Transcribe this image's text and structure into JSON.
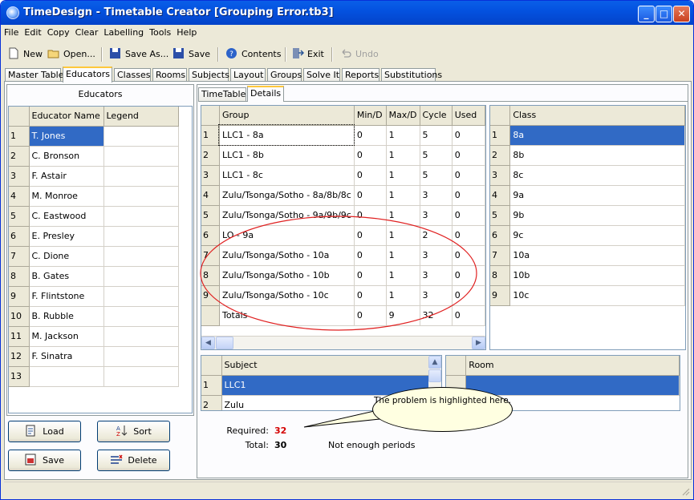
{
  "window": {
    "title": "TimeDesign - Timetable Creator [Grouping Error.tb3]"
  },
  "menu": [
    "File",
    "Edit",
    "Copy",
    "Clear",
    "Labelling",
    "Tools",
    "Help"
  ],
  "toolbar": {
    "new": "New",
    "open": "Open...",
    "save_as": "Save As...",
    "save": "Save",
    "contents": "Contents",
    "exit": "Exit",
    "undo": "Undo"
  },
  "tabs": [
    "Master Table",
    "Educators",
    "Classes",
    "Rooms",
    "Subjects",
    "Layout",
    "Groups",
    "Solve It",
    "Reports",
    "Substitutions"
  ],
  "active_tab": "Educators",
  "educators": {
    "title": "Educators",
    "columns": [
      "Educator Name",
      "Legend"
    ],
    "rows": [
      {
        "n": "1",
        "name": "T. Jones"
      },
      {
        "n": "2",
        "name": "C. Bronson"
      },
      {
        "n": "3",
        "name": "F. Astair"
      },
      {
        "n": "4",
        "name": "M. Monroe"
      },
      {
        "n": "5",
        "name": "C. Eastwood"
      },
      {
        "n": "6",
        "name": "E. Presley"
      },
      {
        "n": "7",
        "name": "C. Dione"
      },
      {
        "n": "8",
        "name": "B. Gates"
      },
      {
        "n": "9",
        "name": "F. Flintstone"
      },
      {
        "n": "10",
        "name": "B. Rubble"
      },
      {
        "n": "11",
        "name": "M. Jackson"
      },
      {
        "n": "12",
        "name": "F. Sinatra"
      },
      {
        "n": "13",
        "name": ""
      }
    ],
    "buttons": {
      "load": "Load",
      "sort": "Sort",
      "save": "Save",
      "delete": "Delete"
    }
  },
  "subtabs": [
    "TimeTable",
    "Details"
  ],
  "groups": {
    "columns": [
      "Group",
      "Min/D",
      "Max/D",
      "Cycle",
      "Used"
    ],
    "rows": [
      {
        "n": "1",
        "group": "LLC1 - 8a",
        "min": "0",
        "max": "1",
        "cycle": "5",
        "used": "0"
      },
      {
        "n": "2",
        "group": "LLC1 - 8b",
        "min": "0",
        "max": "1",
        "cycle": "5",
        "used": "0"
      },
      {
        "n": "3",
        "group": "LLC1 - 8c",
        "min": "0",
        "max": "1",
        "cycle": "5",
        "used": "0"
      },
      {
        "n": "4",
        "group": "Zulu/Tsonga/Sotho - 8a/8b/8c",
        "min": "0",
        "max": "1",
        "cycle": "3",
        "used": "0"
      },
      {
        "n": "5",
        "group": "Zulu/Tsonga/Sotho - 9a/9b/9c",
        "min": "0",
        "max": "1",
        "cycle": "3",
        "used": "0"
      },
      {
        "n": "6",
        "group": "LO - 9a",
        "min": "0",
        "max": "1",
        "cycle": "2",
        "used": "0"
      },
      {
        "n": "7",
        "group": "Zulu/Tsonga/Sotho - 10a",
        "min": "0",
        "max": "1",
        "cycle": "3",
        "used": "0"
      },
      {
        "n": "8",
        "group": "Zulu/Tsonga/Sotho - 10b",
        "min": "0",
        "max": "1",
        "cycle": "3",
        "used": "0"
      },
      {
        "n": "9",
        "group": "Zulu/Tsonga/Sotho - 10c",
        "min": "0",
        "max": "1",
        "cycle": "3",
        "used": "0"
      },
      {
        "n": "",
        "group": "Totals",
        "min": "0",
        "max": "9",
        "cycle": "32",
        "used": "0"
      }
    ]
  },
  "classes": {
    "column": "Class",
    "rows": [
      {
        "n": "1",
        "name": "8a"
      },
      {
        "n": "2",
        "name": "8b"
      },
      {
        "n": "3",
        "name": "8c"
      },
      {
        "n": "4",
        "name": "9a"
      },
      {
        "n": "5",
        "name": "9b"
      },
      {
        "n": "6",
        "name": "9c"
      },
      {
        "n": "7",
        "name": "10a"
      },
      {
        "n": "8",
        "name": "10b"
      },
      {
        "n": "9",
        "name": "10c"
      }
    ]
  },
  "subjects": {
    "column": "Subject",
    "rows": [
      {
        "n": "1",
        "name": "LLC1"
      },
      {
        "n": "2",
        "name": "Zulu"
      }
    ]
  },
  "rooms": {
    "column": "Room"
  },
  "summary": {
    "required_label": "Required:",
    "required_value": "32",
    "total_label": "Total:",
    "total_value": "30",
    "message": "Not enough periods"
  },
  "callout": {
    "text": "The problem is highlighted here."
  },
  "colors": {
    "selection": "#316ac5",
    "error_text": "#d40000",
    "highlight_ellipse": "#e02020"
  }
}
